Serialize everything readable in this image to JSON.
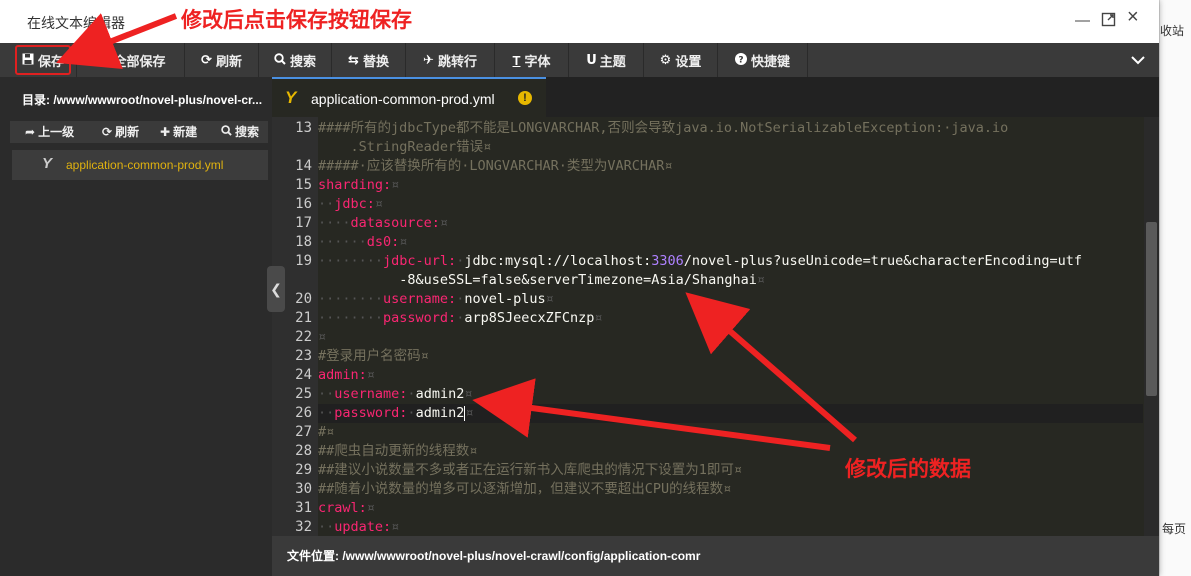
{
  "window": {
    "title": "在线文本编辑器"
  },
  "toolbar": {
    "save": "保存",
    "save_all": "全部保存",
    "refresh": "刷新",
    "search": "搜索",
    "replace": "替换",
    "goto": "跳转行",
    "font": "字体",
    "theme": "主题",
    "settings": "设置",
    "shortcuts": "快捷键"
  },
  "sidebar": {
    "dir": "目录: /www/wwwroot/novel-plus/novel-cr...",
    "up": "上一级",
    "refresh": "刷新",
    "new": "新建",
    "search": "搜索",
    "file": "application-common-prod.yml"
  },
  "tab": {
    "name": "application-common-prod.yml"
  },
  "lines": [
    {
      "n": "13",
      "html": "<span class='c-com'>####所有的jdbcType都不能是LONGVARCHAR,否则会导致java.io.NotSerializableException:·java.io</span>"
    },
    {
      "n": "",
      "html": "<span class='c-com'>    .StringReader错误¤</span>"
    },
    {
      "n": "14",
      "html": "<span class='c-com'>#####·应该替换所有的·LONGVARCHAR·类型为VARCHAR¤</span>"
    },
    {
      "n": "15",
      "html": "<span class='c-key'>sharding:</span><span class='c-ws'>¤</span>"
    },
    {
      "n": "16",
      "html": "<span class='c-ws'>··</span><span class='c-key'>jdbc:</span><span class='c-ws'>¤</span>"
    },
    {
      "n": "17",
      "html": "<span class='c-ws'>····</span><span class='c-key'>datasource:</span><span class='c-ws'>¤</span>"
    },
    {
      "n": "18",
      "html": "<span class='c-ws'>······</span><span class='c-key'>ds0:</span><span class='c-ws'>¤</span>"
    },
    {
      "n": "19",
      "html": "<span class='c-ws'>········</span><span class='c-key'>jdbc-url:</span><span class='c-ws'>·</span>jdbc:mysql://localhost:<span class='c-num'>3306</span>/novel-plus?useUnicode=true&amp;characterEncoding=utf"
    },
    {
      "n": "",
      "html": "          -8&amp;useSSL=false&amp;serverTimezone=Asia/Shanghai<span class='c-ws'>¤</span>"
    },
    {
      "n": "20",
      "html": "<span class='c-ws'>········</span><span class='c-key'>username:</span><span class='c-ws'>·</span>novel-plus<span class='c-ws'>¤</span>"
    },
    {
      "n": "21",
      "html": "<span class='c-ws'>········</span><span class='c-key'>password:</span><span class='c-ws'>·</span>arp8SJeecxZFCnzp<span class='c-ws'>¤</span>"
    },
    {
      "n": "22",
      "html": "<span class='c-ws'>¤</span>"
    },
    {
      "n": "23",
      "html": "<span class='c-com'>#登录用户名密码¤</span>"
    },
    {
      "n": "24",
      "html": "<span class='c-key'>admin:</span><span class='c-ws'>¤</span>"
    },
    {
      "n": "25",
      "html": "<span class='c-ws'>··</span><span class='c-key'>username:</span><span class='c-ws'>·</span>admin2<span class='c-ws'>¤</span>"
    },
    {
      "n": "26",
      "html": "<span class='c-ws'>··</span><span class='c-key'>password:</span><span class='c-ws'>·</span>admin2<span class='cursor'></span><span class='c-ws'>¤</span>",
      "active": true
    },
    {
      "n": "27",
      "html": "<span class='c-com'>#¤</span>"
    },
    {
      "n": "28",
      "html": "<span class='c-com'>##爬虫自动更新的线程数¤</span>"
    },
    {
      "n": "29",
      "html": "<span class='c-com'>##建议小说数量不多或者正在运行新书入库爬虫的情况下设置为1即可¤</span>"
    },
    {
      "n": "30",
      "html": "<span class='c-com'>##随着小说数量的增多可以逐渐增加，但建议不要超出CPU的线程数¤</span>"
    },
    {
      "n": "31",
      "html": "<span class='c-key'>crawl:</span><span class='c-ws'>¤</span>"
    },
    {
      "n": "32",
      "html": "<span class='c-ws'>··</span><span class='c-key'>update:</span><span class='c-ws'>¤</span>"
    }
  ],
  "status": {
    "path": "文件位置: /www/wwwroot/novel-plus/novel-crawl/config/application-comr"
  },
  "annotations": {
    "top": "修改后点击保存按钮保存",
    "mid": "修改后的数据"
  },
  "background": {
    "right_top": "收站",
    "right_bottom": "每页"
  },
  "colors": {
    "accent": "#4a90e2",
    "yaml_key": "#f92672",
    "comment": "#75715e",
    "annotation": "#ee2222",
    "file_highlight": "#e0b20f"
  }
}
